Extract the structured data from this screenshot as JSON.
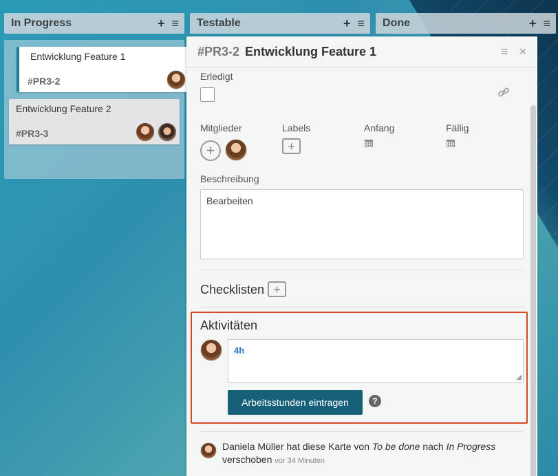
{
  "columns": [
    {
      "title": "In Progress",
      "add_icon": "+",
      "menu_icon": "≡"
    },
    {
      "title": "Testable",
      "add_icon": "+",
      "menu_icon": "≡"
    },
    {
      "title": "Done",
      "add_icon": "+",
      "menu_icon": "≡"
    }
  ],
  "cards": [
    {
      "title": "Entwicklung Feature 1",
      "id": "#PR3-2"
    },
    {
      "title": "Entwicklung Feature 2",
      "id": "#PR3-3"
    }
  ],
  "detail": {
    "id": "#PR3-2",
    "title": "Entwicklung Feature 1",
    "menu_icon": "≡",
    "close_icon": "×",
    "done_label": "Erledigt",
    "members_label": "Mitglieder",
    "labels_label": "Labels",
    "start_label": "Anfang",
    "due_label": "Fällig",
    "add_glyph": "+",
    "description_label": "Beschreibung",
    "description_placeholder": "Bearbeiten",
    "checklists_label": "Checklisten",
    "activities_label": "Aktivitäten",
    "activity_input_value": "4h",
    "submit_button": "Arbeitsstunden eintragen",
    "help_glyph": "?"
  },
  "activity_log": {
    "user": "Daniela Müller",
    "text_1": "hat diese Karte von",
    "from": "To be done",
    "text_2": "nach",
    "to": "In Progress",
    "text_3": "verschoben",
    "time": "vor 34 Minuten"
  },
  "icons": {
    "link": "link-icon",
    "calendar": "calendar-icon"
  }
}
